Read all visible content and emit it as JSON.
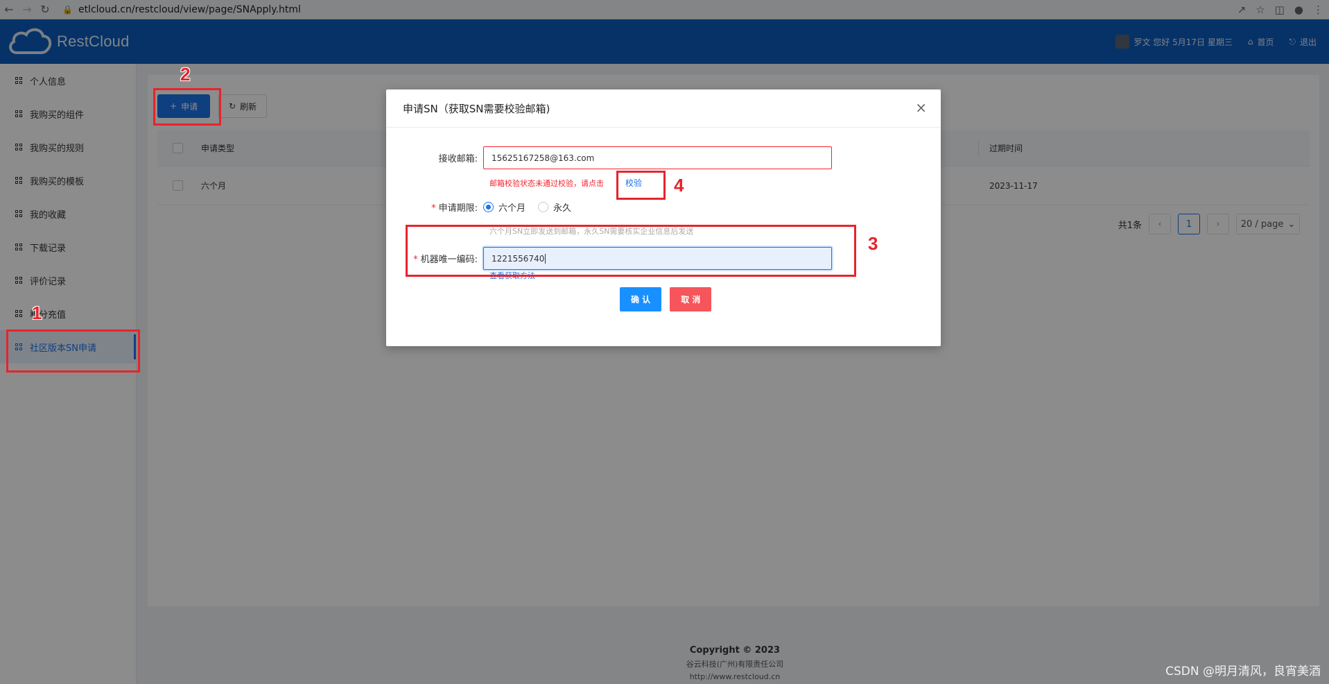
{
  "browser": {
    "url": "etlcloud.cn/restcloud/view/page/SNApply.html"
  },
  "header": {
    "logo_text": "RestCloud",
    "greeting": "罗文 您好 5月17日 星期三",
    "home_label": "首页",
    "logout_label": "退出"
  },
  "sidebar": {
    "items": [
      {
        "label": "个人信息"
      },
      {
        "label": "我购买的组件"
      },
      {
        "label": "我购买的规则"
      },
      {
        "label": "我购买的模板"
      },
      {
        "label": "我的收藏"
      },
      {
        "label": "下载记录"
      },
      {
        "label": "评价记录"
      },
      {
        "label": "积分充值"
      },
      {
        "label": "社区版本SN申请"
      }
    ]
  },
  "toolbar": {
    "apply_label": "申请",
    "refresh_label": "刷新"
  },
  "table": {
    "headers": {
      "type": "申请类型",
      "expire": "过期时间"
    },
    "rows": [
      {
        "type": "六个月",
        "expire": "2023-11-17"
      }
    ]
  },
  "pagination": {
    "total": "共1条",
    "current_page": "1",
    "page_size": "20 / page"
  },
  "footer": {
    "copyright": "Copyright © 2023",
    "company": "谷云科技(广州)有限责任公司",
    "site": "http://www.restcloud.cn"
  },
  "modal": {
    "title": "申请SN（获取SN需要校验邮箱)",
    "email_label": "接收邮箱:",
    "email_value": "15625167258@163.com",
    "email_error": "邮箱校验状态未通过校验，请点击",
    "verify_link": "校验",
    "period_label": "申请期限:",
    "period_options": [
      "六个月",
      "永久"
    ],
    "period_selected": "六个月",
    "period_hint": "六个月SN立即发送到邮箱，永久SN需要核实企业信息后发送",
    "machine_label": "机器唯一编码:",
    "machine_value": "1221556740",
    "machine_help_link": "查看获取方法",
    "confirm_label": "确 认",
    "cancel_label": "取 消"
  },
  "annotations": [
    "1",
    "2",
    "3",
    "4"
  ],
  "watermark": "CSDN @明月清风，良宵美酒",
  "colors": {
    "header_bg": "#0c5bbd",
    "primary": "#1a73e8",
    "danger": "#f5222d",
    "annotation": "#e6242b"
  }
}
